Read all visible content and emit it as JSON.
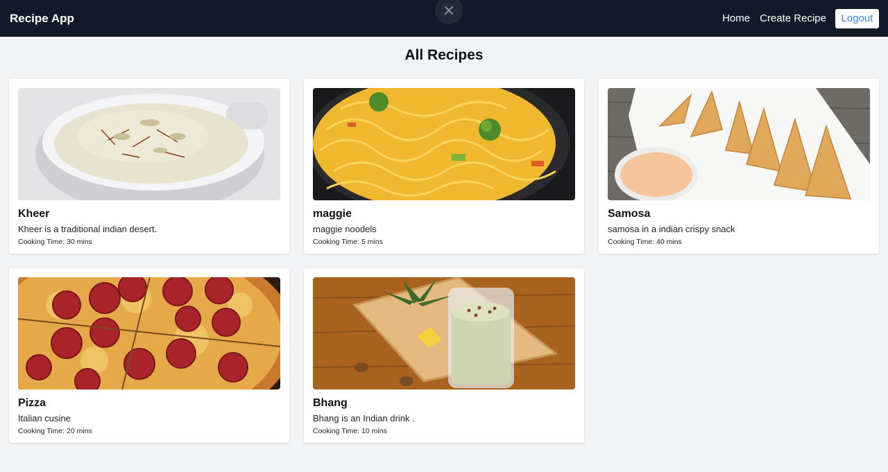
{
  "nav": {
    "brand": "Recipe App",
    "home": "Home",
    "create": "Create Recipe",
    "logout": "Logout"
  },
  "page": {
    "title": "All Recipes"
  },
  "recipes": [
    {
      "title": "Kheer",
      "description": "Kheer is a traditional indian desert.",
      "time": "Cooking Time: 30 mins",
      "image": "kheer-bowl-photo"
    },
    {
      "title": "maggie",
      "description": "maggie noodels",
      "time": "Cooking Time: 5 mins",
      "image": "noodles-bowl-photo"
    },
    {
      "title": "Samosa",
      "description": "samosa in a indian crispy snack",
      "time": "Cooking Time: 40 mins",
      "image": "samosa-plate-photo"
    },
    {
      "title": "Pizza",
      "description": "Italian cusine",
      "time": "Cooking Time: 20 mins",
      "image": "pepperoni-pizza-photo"
    },
    {
      "title": "Bhang",
      "description": "Bhang is an Indian drink .",
      "time": "Cooking Time: 10 mins",
      "image": "bhang-glass-photo"
    }
  ],
  "colors": {
    "navbar": "#121a2a",
    "background": "#f2f3f5",
    "accent": "#3b82f6"
  },
  "icons": {
    "close": "close-icon"
  }
}
